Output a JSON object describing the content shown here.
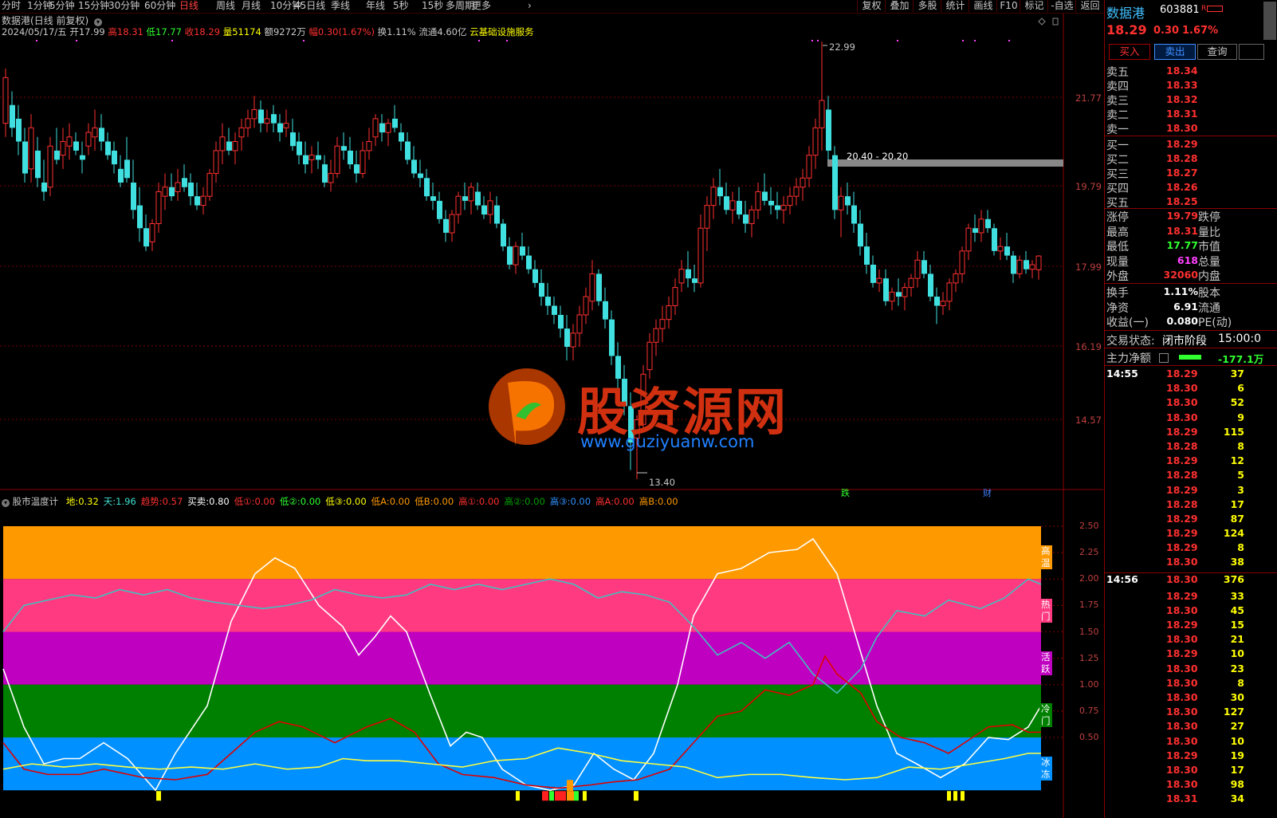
{
  "toolbar": {
    "periods": [
      "分时",
      "1分钟",
      "5分钟",
      "15分钟",
      "30分钟",
      "60分钟",
      "日线",
      "周线",
      "月线",
      "10分钟",
      "45日线",
      "季线",
      "年线",
      "5秒",
      "15秒",
      "多周期",
      "更多"
    ],
    "active_period": "日线",
    "right_tools": [
      "复权",
      "叠加",
      "多股",
      "统计",
      "画线",
      "F10",
      "标记",
      "-自选",
      "返回"
    ]
  },
  "ticker": {
    "name": "数据港",
    "mode": "(日线 前复权)"
  },
  "info": {
    "date": "2024/05/17/五",
    "open_label": "开",
    "open": "17.99",
    "high_label": "高",
    "high": "18.31",
    "low_label": "低",
    "low": "17.77",
    "close_label": "收",
    "close": "18.29",
    "vol_label": "量",
    "vol": "51174",
    "amount_label": "额",
    "amount": "9272万",
    "pct_label": "幅",
    "pct": "0.30(1.67%)",
    "turnover_label": "换",
    "turnover": "1.11%",
    "float_label": "流通",
    "float": "4.60亿",
    "sector": "云基础设施服务"
  },
  "price_axis": [
    "21.77",
    "19.79",
    "17.99",
    "16.19",
    "14.57"
  ],
  "annotations": {
    "max_label": "22.99",
    "min_label": "13.40",
    "range_label": "20.40 - 20.20",
    "event_1": "跌",
    "event_2": "财"
  },
  "watermark": {
    "title": "股资源网",
    "url": "www.guziyuanw.com"
  },
  "indicator": {
    "name": "股市温度计",
    "params": [
      {
        "label": "地:",
        "value": "0.32",
        "color": "#ffff00"
      },
      {
        "label": "天:",
        "value": "1.96",
        "color": "#40e0d0"
      },
      {
        "label": "趋势:",
        "value": "0.57",
        "color": "#ff3030"
      },
      {
        "label": "买卖:",
        "value": "0.80",
        "color": "#ffffff"
      },
      {
        "label": "低①:",
        "value": "0.00",
        "color": "#ff3030"
      },
      {
        "label": "低②:",
        "value": "0.00",
        "color": "#30ff30"
      },
      {
        "label": "低③:",
        "value": "0.00",
        "color": "#ffff00"
      },
      {
        "label": "低A:",
        "value": "0.00",
        "color": "#ff9900"
      },
      {
        "label": "低B:",
        "value": "0.00",
        "color": "#ff9900"
      },
      {
        "label": "高①:",
        "value": "0.00",
        "color": "#ff3030"
      },
      {
        "label": "高②:",
        "value": "0.00",
        "color": "#00a000"
      },
      {
        "label": "高③:",
        "value": "0.00",
        "color": "#3090ff"
      },
      {
        "label": "高A:",
        "value": "0.00",
        "color": "#ff3030"
      },
      {
        "label": "高B:",
        "value": "0.00",
        "color": "#ff9900"
      }
    ],
    "axis": [
      "2.50",
      "2.25",
      "2.00",
      "1.75",
      "1.50",
      "1.25",
      "1.00",
      "0.75",
      "0.50"
    ],
    "zones": [
      {
        "label": "高温",
        "color": "#ff9900"
      },
      {
        "label": "热门",
        "color": "#ff3a80"
      },
      {
        "label": "活跃",
        "color": "#c000c0"
      },
      {
        "label": "冷门",
        "color": "#008000"
      },
      {
        "label": "冰冻",
        "color": "#0090ff"
      }
    ]
  },
  "quote": {
    "name": "数据港",
    "code": "603881",
    "tag": "R",
    "price": "18.29",
    "change": "0.30",
    "pct": "1.67%",
    "buy_button": "买入",
    "sell_button": "卖出",
    "query_button": "查询",
    "asks": [
      {
        "label": "卖五",
        "price": "18.34"
      },
      {
        "label": "卖四",
        "price": "18.33"
      },
      {
        "label": "卖三",
        "price": "18.32"
      },
      {
        "label": "卖二",
        "price": "18.31"
      },
      {
        "label": "卖一",
        "price": "18.30"
      }
    ],
    "bids": [
      {
        "label": "买一",
        "price": "18.29"
      },
      {
        "label": "买二",
        "price": "18.28"
      },
      {
        "label": "买三",
        "price": "18.27"
      },
      {
        "label": "买四",
        "price": "18.26"
      },
      {
        "label": "买五",
        "price": "18.25"
      }
    ],
    "stats": [
      {
        "l1": "涨停",
        "v1": "19.79",
        "c1": "#ff3030",
        "l2": "跌停"
      },
      {
        "l1": "最高",
        "v1": "18.31",
        "c1": "#ff3030",
        "l2": "量比"
      },
      {
        "l1": "最低",
        "v1": "17.77",
        "c1": "#30ff30",
        "l2": "市值"
      },
      {
        "l1": "现量",
        "v1": "618",
        "c1": "#ff40ff",
        "l2": "总量"
      },
      {
        "l1": "外盘",
        "v1": "32060",
        "c1": "#ff3030",
        "l2": "内盘"
      }
    ],
    "stats2": [
      {
        "l1": "换手",
        "v1": "1.11%",
        "l2": "股本"
      },
      {
        "l1": "净资",
        "v1": "6.91",
        "l2": "流通"
      },
      {
        "l1": "收益(一)",
        "v1": "0.080",
        "l2": "PE(动)"
      }
    ],
    "trade_status_label": "交易状态:",
    "trade_status": "闭市阶段",
    "trade_time": "15:00:0",
    "main_flow_label": "主力净额",
    "main_flow_value": "-177.1万"
  },
  "ticks": [
    {
      "time": "14:55",
      "price": "18.29",
      "vol": "37",
      "pc": "#ff3030",
      "vc": "#ffff00"
    },
    {
      "time": "",
      "price": "18.30",
      "vol": "6",
      "pc": "#ff3030",
      "vc": "#ffff00"
    },
    {
      "time": "",
      "price": "18.30",
      "vol": "52",
      "pc": "#ff3030",
      "vc": "#ffff00"
    },
    {
      "time": "",
      "price": "18.30",
      "vol": "9",
      "pc": "#ff3030",
      "vc": "#ffff00"
    },
    {
      "time": "",
      "price": "18.29",
      "vol": "115",
      "pc": "#ff3030",
      "vc": "#ffff00"
    },
    {
      "time": "",
      "price": "18.28",
      "vol": "8",
      "pc": "#ff3030",
      "vc": "#ffff00"
    },
    {
      "time": "",
      "price": "18.29",
      "vol": "12",
      "pc": "#ff3030",
      "vc": "#ffff00"
    },
    {
      "time": "",
      "price": "18.28",
      "vol": "5",
      "pc": "#ff3030",
      "vc": "#ffff00"
    },
    {
      "time": "",
      "price": "18.29",
      "vol": "3",
      "pc": "#ff3030",
      "vc": "#ffff00"
    },
    {
      "time": "",
      "price": "18.28",
      "vol": "17",
      "pc": "#ff3030",
      "vc": "#ffff00"
    },
    {
      "time": "",
      "price": "18.29",
      "vol": "87",
      "pc": "#ff3030",
      "vc": "#ffff00"
    },
    {
      "time": "",
      "price": "18.29",
      "vol": "124",
      "pc": "#ff3030",
      "vc": "#ffff00"
    },
    {
      "time": "",
      "price": "18.29",
      "vol": "8",
      "pc": "#ff3030",
      "vc": "#ffff00"
    },
    {
      "time": "",
      "price": "18.30",
      "vol": "38",
      "pc": "#ff3030",
      "vc": "#ffff00"
    },
    {
      "time": "14:56",
      "price": "18.30",
      "vol": "376",
      "pc": "#ff3030",
      "vc": "#ffff00"
    },
    {
      "time": "",
      "price": "18.29",
      "vol": "33",
      "pc": "#ff3030",
      "vc": "#ffff00"
    },
    {
      "time": "",
      "price": "18.30",
      "vol": "45",
      "pc": "#ff3030",
      "vc": "#ffff00"
    },
    {
      "time": "",
      "price": "18.29",
      "vol": "15",
      "pc": "#ff3030",
      "vc": "#ffff00"
    },
    {
      "time": "",
      "price": "18.30",
      "vol": "21",
      "pc": "#ff3030",
      "vc": "#ffff00"
    },
    {
      "time": "",
      "price": "18.29",
      "vol": "10",
      "pc": "#ff3030",
      "vc": "#ffff00"
    },
    {
      "time": "",
      "price": "18.30",
      "vol": "23",
      "pc": "#ff3030",
      "vc": "#ffff00"
    },
    {
      "time": "",
      "price": "18.30",
      "vol": "8",
      "pc": "#ff3030",
      "vc": "#ffff00"
    },
    {
      "time": "",
      "price": "18.30",
      "vol": "30",
      "pc": "#ff3030",
      "vc": "#ffff00"
    },
    {
      "time": "",
      "price": "18.30",
      "vol": "127",
      "pc": "#ff3030",
      "vc": "#ffff00"
    },
    {
      "time": "",
      "price": "18.30",
      "vol": "27",
      "pc": "#ff3030",
      "vc": "#ffff00"
    },
    {
      "time": "",
      "price": "18.30",
      "vol": "10",
      "pc": "#ff3030",
      "vc": "#ffff00"
    },
    {
      "time": "",
      "price": "18.29",
      "vol": "19",
      "pc": "#ff3030",
      "vc": "#ffff00"
    },
    {
      "time": "",
      "price": "18.30",
      "vol": "17",
      "pc": "#ff3030",
      "vc": "#ffff00"
    },
    {
      "time": "",
      "price": "18.30",
      "vol": "98",
      "pc": "#ff3030",
      "vc": "#ffff00"
    },
    {
      "time": "",
      "price": "18.31",
      "vol": "34",
      "pc": "#ff3030",
      "vc": "#ffff00"
    }
  ]
}
